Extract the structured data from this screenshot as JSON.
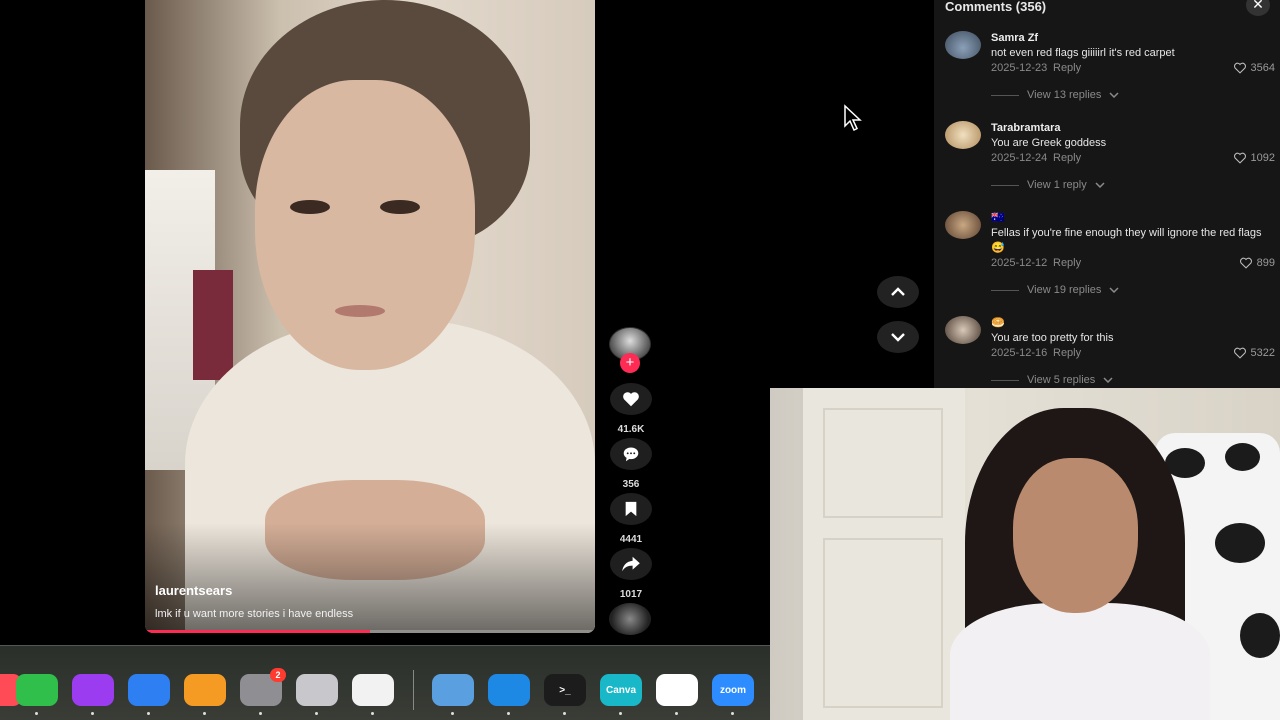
{
  "video": {
    "username": "laurentsears",
    "caption": "lmk if u want more stories i have endless",
    "progress_fraction": 0.5
  },
  "actions": {
    "follow_symbol": "+",
    "likes": "41.6K",
    "comments": "356",
    "saves": "4441",
    "shares": "1017"
  },
  "comments_panel": {
    "title": "Comments (356)",
    "close_symbol": "✕",
    "reply_label": "Reply",
    "items": [
      {
        "name": "Samra Zf",
        "text": "not even red flags giiiiirl it's red carpet",
        "date": "2025-12-23",
        "likes": "3564",
        "view_replies": "View 13 replies"
      },
      {
        "name": "Tarabramtara",
        "text": "You are Greek goddess",
        "date": "2025-12-24",
        "likes": "1092",
        "view_replies": "View 1 reply"
      },
      {
        "name": "🇦🇺",
        "text": "Fellas if you're fine enough they will ignore the red flags😅",
        "date": "2025-12-12",
        "likes": "899",
        "view_replies": "View 19 replies"
      },
      {
        "name": "🥯",
        "text": "You are too pretty for this",
        "date": "2025-12-16",
        "likes": "5322",
        "view_replies": "View 5 replies"
      }
    ]
  },
  "dock": {
    "apps": [
      {
        "name": "Numbers",
        "color": "#2fbf4a",
        "label": ""
      },
      {
        "name": "Podcasts",
        "color": "#9b3cf0",
        "label": ""
      },
      {
        "name": "Keynote",
        "color": "#2d7ff2",
        "label": ""
      },
      {
        "name": "Pages",
        "color": "#f59a23",
        "label": ""
      },
      {
        "name": "System Settings",
        "color": "#8e8e93",
        "label": "",
        "badge": "2"
      },
      {
        "name": "iPhone Mirroring",
        "color": "#c7c7cc",
        "label": ""
      },
      {
        "name": "Freeform",
        "color": "#f2f2f2",
        "label": ""
      },
      {
        "name": "Preview",
        "color": "#5aa0e0",
        "label": ""
      },
      {
        "name": "Bluetooth",
        "color": "#1e88e5",
        "label": ""
      },
      {
        "name": "Terminal",
        "color": "#1c1c1c",
        "label": ">_"
      },
      {
        "name": "Canva",
        "color": "#18b8c9",
        "label": "Canva"
      },
      {
        "name": "VS Code",
        "color": "#ffffff",
        "label": ""
      },
      {
        "name": "Zoom",
        "color": "#2d8cff",
        "label": "zoom"
      }
    ]
  },
  "colors": {
    "accent": "#fe2c55",
    "panel_bg": "#161616"
  }
}
